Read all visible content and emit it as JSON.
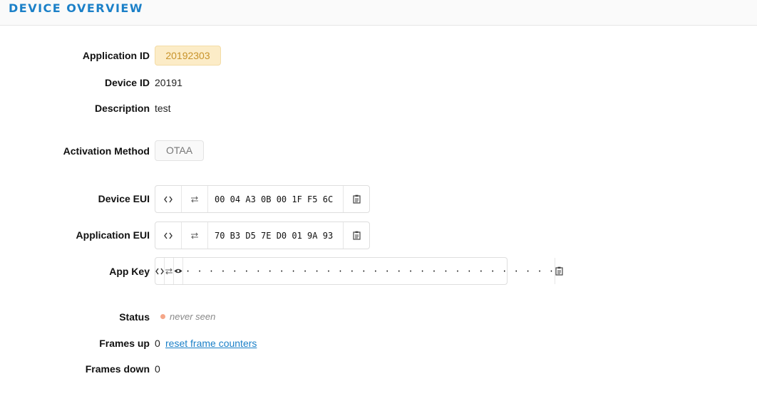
{
  "header": {
    "title": "DEVICE OVERVIEW"
  },
  "fields": {
    "application_id": {
      "label": "Application ID",
      "value": "20192303"
    },
    "device_id": {
      "label": "Device ID",
      "value": "20191"
    },
    "description": {
      "label": "Description",
      "value": "test"
    },
    "activation_method": {
      "label": "Activation Method",
      "value": "OTAA"
    },
    "device_eui": {
      "label": "Device EUI",
      "value": "00 04 A3 0B 00 1F F5 6C"
    },
    "application_eui": {
      "label": "Application EUI",
      "value": "70 B3 D5 7E D0 01 9A 93"
    },
    "app_key": {
      "label": "App Key",
      "value": "· · · · · · · · · · · · · · · · · · · · · · · · · · · · · · · ·"
    },
    "status": {
      "label": "Status",
      "value": "never seen",
      "dot_color": "#f5a688"
    },
    "frames_up": {
      "label": "Frames up",
      "value": "0",
      "link": "reset frame counters"
    },
    "frames_down": {
      "label": "Frames down",
      "value": "0"
    }
  },
  "icons": {
    "toggle_format": "code-brackets-icon",
    "swap_order": "swap-arrows-icon",
    "show_key": "eye-icon",
    "copy": "clipboard-icon"
  },
  "colors": {
    "accent": "#1b80c8",
    "app_tag_bg": "#fcecc7",
    "app_tag_text": "#c8932b"
  }
}
